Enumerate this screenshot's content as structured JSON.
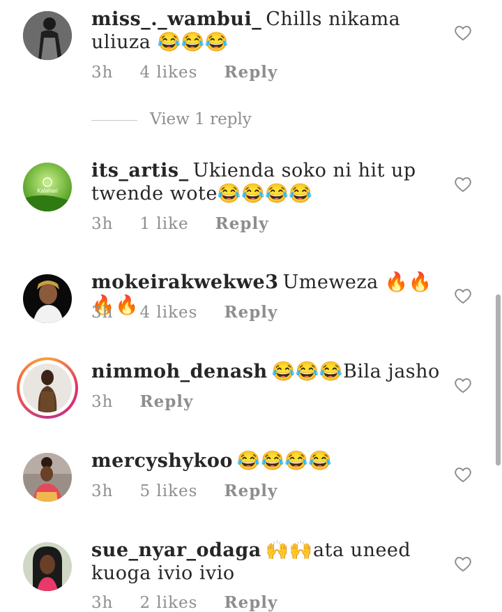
{
  "comments": [
    {
      "username": "miss_._wambui_",
      "text": "Chills nikama uliuza 😂😂😂",
      "time": "3h",
      "likes": "4 likes",
      "reply": "Reply",
      "view_replies": "View 1 reply"
    },
    {
      "username": "its_artis_",
      "text": "Ukienda soko ni hit up twende wote😂😂😂😂",
      "time": "3h",
      "likes": "1 like",
      "reply": "Reply",
      "avatar_label": "Kalahari"
    },
    {
      "username": "mokeirakwekwe3",
      "text": "Umeweza 🔥🔥🔥🔥",
      "time": "3h",
      "likes": "4 likes",
      "reply": "Reply"
    },
    {
      "username": "nimmoh_denash",
      "text": "😂😂😂Bila jasho",
      "time": "3h",
      "reply": "Reply"
    },
    {
      "username": "mercyshykoo",
      "text": "😂😂😂😂",
      "time": "3h",
      "likes": "5 likes",
      "reply": "Reply"
    },
    {
      "username": "sue_nyar_odaga",
      "text": "🙌🙌ata uneed kuoga ivio ivio",
      "time": "3h",
      "likes": "2 likes",
      "reply": "Reply"
    }
  ],
  "icons": {
    "like": "heart-outline-icon"
  }
}
